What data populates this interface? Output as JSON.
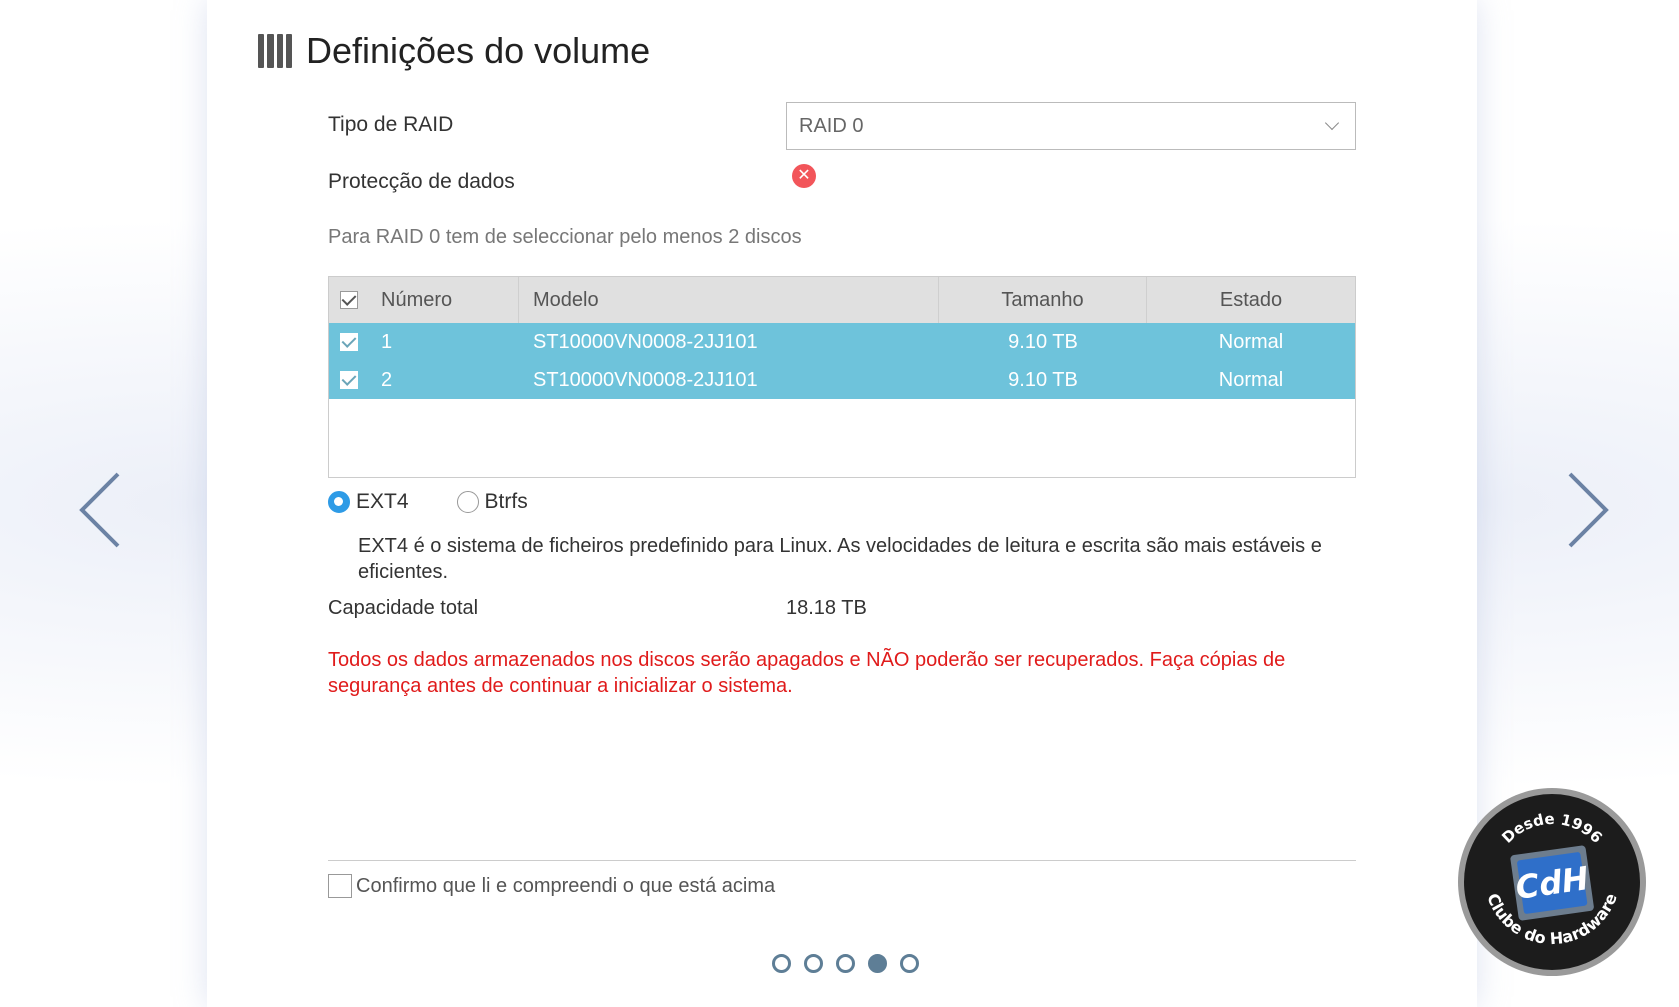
{
  "header": {
    "title": "Definições do volume",
    "icon": "disk-bays-icon"
  },
  "raid": {
    "label": "Tipo de RAID",
    "selected": "RAID 0",
    "protection_label": "Protecção de dados",
    "protection_icon": "error-x-icon",
    "hint": "Para RAID 0 tem de seleccionar pelo menos 2 discos"
  },
  "disk_table": {
    "columns": [
      "Número",
      "Modelo",
      "Tamanho",
      "Estado"
    ],
    "rows": [
      {
        "num": "1",
        "model": "ST10000VN0008-2JJ101",
        "size": "9.10 TB",
        "state": "Normal",
        "checked": true
      },
      {
        "num": "2",
        "model": "ST10000VN0008-2JJ101",
        "size": "9.10 TB",
        "state": "Normal",
        "checked": true
      }
    ],
    "row_color": "#6ec3db"
  },
  "filesystem": {
    "options": [
      "EXT4",
      "Btrfs"
    ],
    "selected": "EXT4",
    "description": "EXT4 é o sistema de ficheiros predefinido para Linux. As velocidades de leitura e escrita são mais estáveis e eficientes."
  },
  "capacity": {
    "label": "Capacidade total",
    "value": "18.18 TB"
  },
  "warning": "Todos os dados armazenados nos discos serão apagados e NÃO poderão ser recuperados. Faça cópias de segurança antes de continuar a inicializar o sistema.",
  "confirm": {
    "label": "Confirmo que li e compreendi o que está acima",
    "checked": false
  },
  "pager": {
    "total": 5,
    "current": 4
  },
  "watermark": {
    "brand": "CdH",
    "text_top": "Desde 1996",
    "text_bottom": "Clube do Hardware"
  },
  "colors": {
    "warning": "#e01b1b",
    "accent": "#2e9be6",
    "dot": "#5e7e96"
  }
}
